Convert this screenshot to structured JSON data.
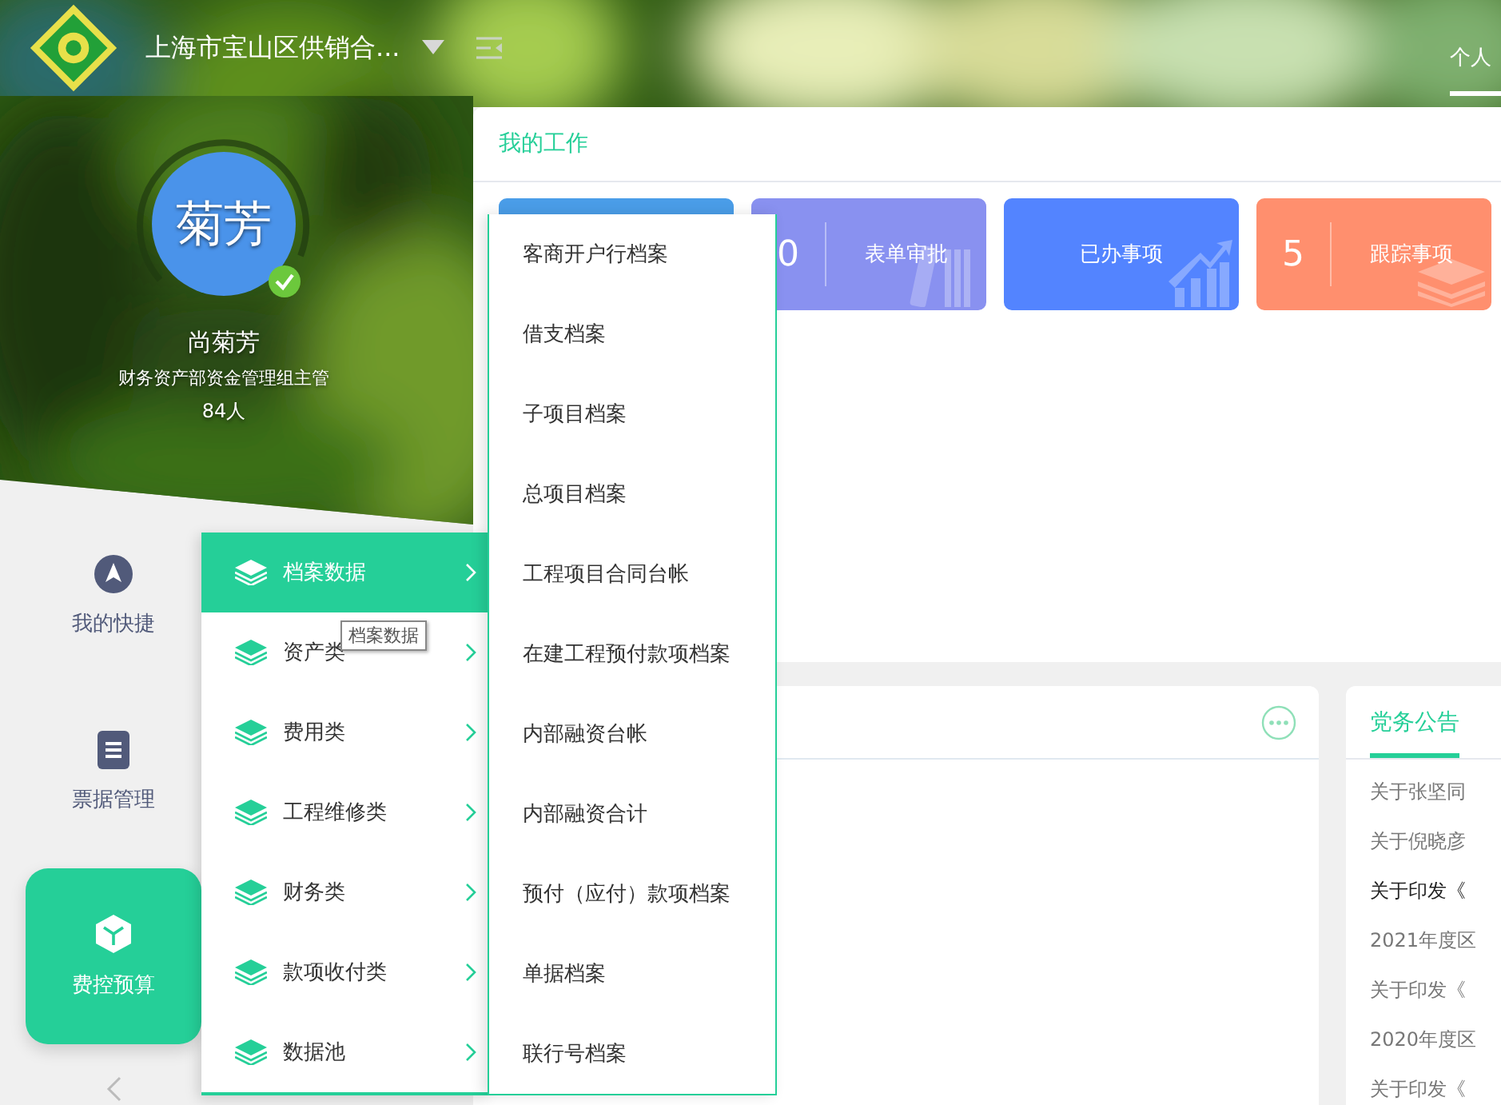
{
  "header": {
    "org_title": "上海市宝山区供销合...",
    "tabs": [
      {
        "label": "个人",
        "selected": true
      }
    ]
  },
  "profile": {
    "avatar_text": "菊芳",
    "verified": true,
    "name": "尚菊芳",
    "position": "财务资产部资金管理组主管",
    "count": "84人"
  },
  "sidebar": {
    "items": [
      {
        "label": "我的快捷",
        "kind": "shortcut",
        "selected": false
      },
      {
        "label": "票据管理",
        "kind": "bill",
        "selected": false
      },
      {
        "label": "费控预算",
        "kind": "budget",
        "selected": true
      }
    ]
  },
  "work_card": {
    "title": "我的工作",
    "tiles": [
      {
        "kind": "plain",
        "color": "#4a9de8"
      },
      {
        "kind": "approval",
        "count": "0",
        "label": "表单审批",
        "color": "#8991f0"
      },
      {
        "kind": "done",
        "label": "已办事项",
        "color": "#5384ff"
      },
      {
        "kind": "tracking",
        "count": "5",
        "label": "跟踪事项",
        "color": "#ff8f6e"
      }
    ]
  },
  "notice_card": {
    "title": "党务公告",
    "items": [
      {
        "text": "关于张坚同",
        "highlighted": false
      },
      {
        "text": "关于倪晓彦",
        "highlighted": false
      },
      {
        "text": "关于印发《",
        "highlighted": true
      },
      {
        "text": "2021年度区",
        "highlighted": false
      },
      {
        "text": "关于印发《",
        "highlighted": false
      },
      {
        "text": "2020年度区",
        "highlighted": false
      },
      {
        "text": "关于印发《",
        "highlighted": false
      }
    ]
  },
  "category_menu": {
    "items": [
      {
        "label": "档案数据",
        "selected": true
      },
      {
        "label": "资产类",
        "selected": false
      },
      {
        "label": "费用类",
        "selected": false
      },
      {
        "label": "工程维修类",
        "selected": false
      },
      {
        "label": "财务类",
        "selected": false
      },
      {
        "label": "款项收付类",
        "selected": false
      },
      {
        "label": "数据池",
        "selected": false
      }
    ],
    "tooltip": "档案数据"
  },
  "archive_menu": {
    "items": [
      "客商开户行档案",
      "借支档案",
      "子项目档案",
      "总项目档案",
      "工程项目合同台帐",
      "在建工程预付款项档案",
      "内部融资台帐",
      "内部融资合计",
      "预付（应付）款项档案",
      "单据档案",
      "联行号档案"
    ]
  }
}
